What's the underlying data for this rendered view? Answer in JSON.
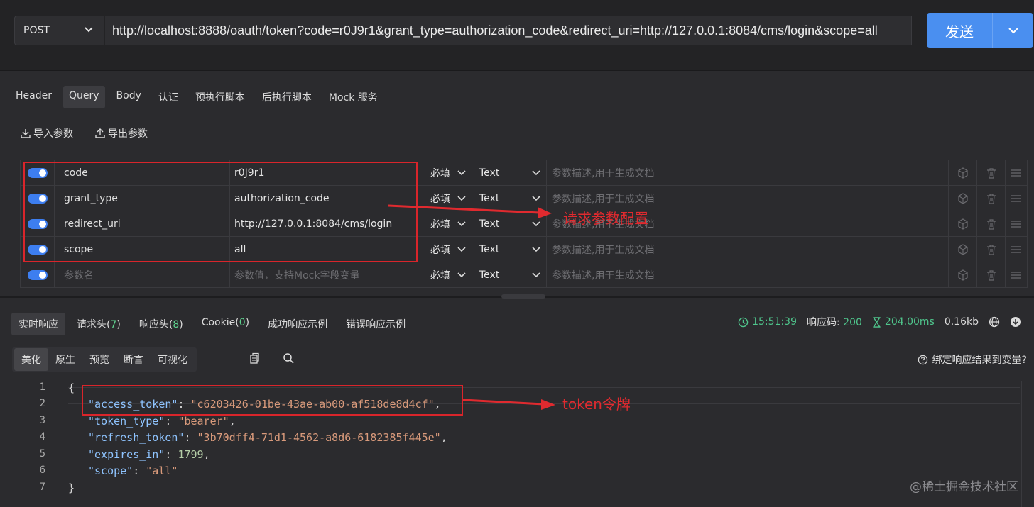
{
  "request": {
    "method": "POST",
    "url": "http://localhost:8888/oauth/token?code=r0J9r1&grant_type=authorization_code&redirect_uri=http://127.0.0.1:8084/cms/login&scope=all",
    "send_label": "发送"
  },
  "tabs": [
    "Header",
    "Query",
    "Body",
    "认证",
    "预执行脚本",
    "后执行脚本",
    "Mock 服务"
  ],
  "active_tab": "Query",
  "tools": {
    "import_label": "导入参数",
    "export_label": "导出参数"
  },
  "params": [
    {
      "name": "code",
      "value": "r0J9r1",
      "required": "必填",
      "type": "Text",
      "desc": "参数描述,用于生成文档"
    },
    {
      "name": "grant_type",
      "value": "authorization_code",
      "required": "必填",
      "type": "Text",
      "desc": "参数描述,用于生成文档"
    },
    {
      "name": "redirect_uri",
      "value": "http://127.0.0.1:8084/cms/login",
      "required": "必填",
      "type": "Text",
      "desc": "参数描述,用于生成文档"
    },
    {
      "name": "scope",
      "value": "all",
      "required": "必填",
      "type": "Text",
      "desc": "参数描述,用于生成文档"
    }
  ],
  "new_param": {
    "name_placeholder": "参数名",
    "value_placeholder": "参数值，支持Mock字段变量",
    "required": "必填",
    "type": "Text",
    "desc": "参数描述,用于生成文档"
  },
  "annotations": {
    "params": "请求参数配置",
    "token": "token令牌"
  },
  "response_tabs": {
    "realtime": "实时响应",
    "req_headers_label": "请求头(",
    "req_headers_count": "7",
    "resp_headers_label": "响应头(",
    "resp_headers_count": "8",
    "cookie_label": "Cookie(",
    "cookie_count": "0",
    "close_paren": ")",
    "success_example": "成功响应示例",
    "error_example": "错误响应示例"
  },
  "status": {
    "time": "15:51:39",
    "code_label": "响应码:",
    "code": "200",
    "duration": "204.00ms",
    "size": "0.16kb"
  },
  "view_tabs": [
    "美化",
    "原生",
    "预览",
    "断言",
    "可视化"
  ],
  "bind_label": "绑定响应结果到变量?",
  "response_body": {
    "line_numbers": [
      "1",
      "2",
      "3",
      "4",
      "5",
      "6",
      "7"
    ],
    "open": "{",
    "close": "}",
    "fields": [
      {
        "key": "\"access_token\"",
        "value": "\"c6203426-01be-43ae-ab00-af518de8d4cf\"",
        "trail": ","
      },
      {
        "key": "\"token_type\"",
        "value": "\"bearer\"",
        "trail": ","
      },
      {
        "key": "\"refresh_token\"",
        "value": "\"3b70dff4-71d1-4562-a8d6-6182385f445e\"",
        "trail": ","
      },
      {
        "key": "\"expires_in\"",
        "value": "1799",
        "trail": ","
      },
      {
        "key": "\"scope\"",
        "value": "\"all\"",
        "trail": ""
      }
    ]
  },
  "watermark": "@稀土掘金技术社区"
}
